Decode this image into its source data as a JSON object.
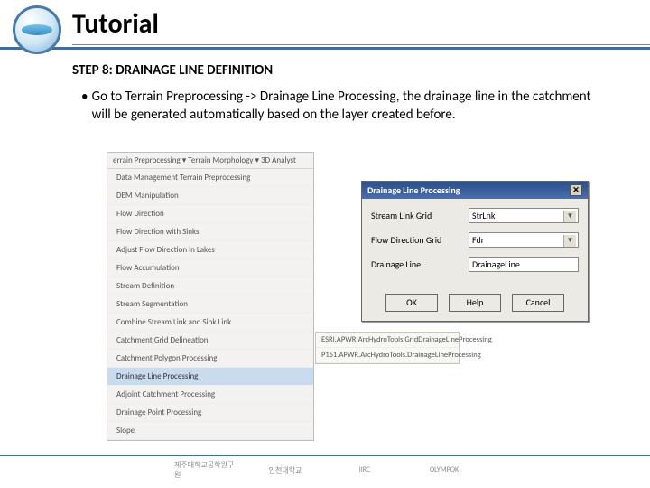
{
  "header": {
    "title": "Tutorial"
  },
  "step": "STEP 8: DRAINAGE LINE DEFINITION",
  "bullet": "Go to Terrain Preprocessing -> Drainage Line Processing, the drainage line in the catchment will be generated automatically based on the layer created before.",
  "menu": {
    "toolbar": "errain Preprocessing ▾   Terrain Morphology ▾             3D Analyst",
    "items": [
      "Data Management Terrain Preprocessing",
      "DEM Manipulation",
      "Flow Direction",
      "Flow Direction with Sinks",
      "Adjust Flow Direction in Lakes",
      "Flow Accumulation",
      "Stream Definition",
      "Stream Segmentation",
      "Combine Stream Link and Sink Link",
      "Catchment Grid Delineation",
      "Catchment Polygon Processing",
      "Drainage Line Processing",
      "Adjoint Catchment Processing",
      "Drainage Point Processing",
      "Slope"
    ],
    "highlight_index": 11,
    "flyout": [
      "ESRI.APWR.ArcHydroTools.GridDrainageLineProcessing",
      "P151.APWR.ArcHydroTools.DrainageLineProcessing"
    ]
  },
  "dialog": {
    "title": "Drainage Line Processing",
    "fields": [
      {
        "label": "Stream Link Grid",
        "value": "StrLnk",
        "type": "select"
      },
      {
        "label": "Flow Direction Grid",
        "value": "Fdr",
        "type": "select"
      },
      {
        "label": "Drainage Line",
        "value": "DrainageLine",
        "type": "output"
      }
    ],
    "buttons": {
      "ok": "OK",
      "help": "Help",
      "cancel": "Cancel"
    }
  },
  "footer": {
    "badges": [
      "제주대학교공학원구원",
      "인천대학교",
      "IIRC",
      "OLYMPOK"
    ]
  }
}
